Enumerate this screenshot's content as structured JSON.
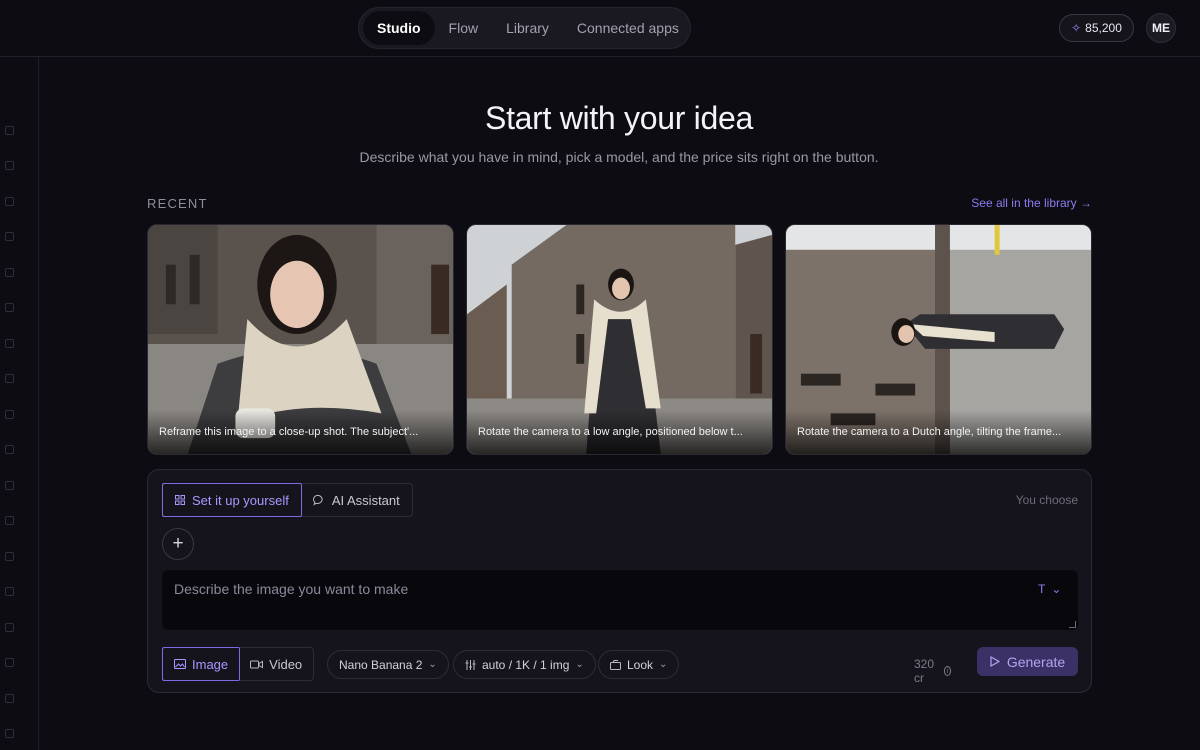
{
  "nav": {
    "tabs": [
      {
        "label": "Studio",
        "active": true
      },
      {
        "label": "Flow",
        "active": false
      },
      {
        "label": "Library",
        "active": false
      },
      {
        "label": "Connected apps",
        "active": false
      }
    ]
  },
  "header": {
    "credits": "85,200",
    "credits_icon": "sparkle-icon",
    "avatar_initials": "ME"
  },
  "hero": {
    "title": "Start with your idea",
    "subtitle": "Describe what you have in mind, pick a model, and the price sits right on the button."
  },
  "recent": {
    "label": "RECENT",
    "see_all": "See all in the library →",
    "items": [
      {
        "caption": "Reframe this image to a close-up shot. The subject'..."
      },
      {
        "caption": "Rotate the camera to a low angle, positioned below t..."
      },
      {
        "caption": "Rotate the camera to a Dutch angle, tilting the frame..."
      }
    ]
  },
  "composer": {
    "modes": [
      {
        "label": "Set it up yourself",
        "icon": "grid-icon",
        "active": true
      },
      {
        "label": "AI Assistant",
        "icon": "chat-bubble-icon",
        "active": false
      }
    ],
    "you_choose": "You choose",
    "add_icon": "plus-icon",
    "prompt_placeholder": "Describe the image you want to make",
    "text_type_label": "T",
    "media": [
      {
        "label": "Image",
        "icon": "image-icon",
        "active": true
      },
      {
        "label": "Video",
        "icon": "video-icon",
        "active": false
      }
    ],
    "model": "Nano Banana 2",
    "settings": "auto / 1K / 1 img",
    "look": "Look",
    "cost": "320 cr",
    "generate_label": "Generate"
  },
  "colors": {
    "background": "#0d0c12",
    "accent": "#8b7cf2",
    "generate_bg": "#3c3167"
  }
}
